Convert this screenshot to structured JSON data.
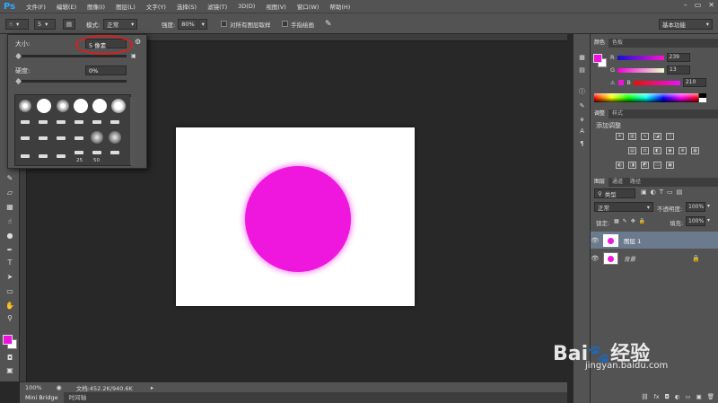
{
  "menubar": {
    "logo": "Ps",
    "items": [
      "文件(F)",
      "编辑(E)",
      "图像(I)",
      "图层(L)",
      "文字(Y)",
      "选择(S)",
      "滤镜(T)",
      "3D(D)",
      "视图(V)",
      "窗口(W)",
      "帮助(H)"
    ],
    "window_controls": [
      "–",
      "▭",
      "✕"
    ]
  },
  "options": {
    "brush_size": "5",
    "mode_label": "模式:",
    "mode_value": "正常",
    "strength_label": "强度:",
    "strength_value": "80%",
    "sample_all_label": "对所有图层取样",
    "finger_paint_label": "手指绘画",
    "workspace_value": "基本功能"
  },
  "brush_popup": {
    "size_label": "大小:",
    "size_value": "5 像素",
    "hardness_label": "硬度:",
    "hardness_value": "0%",
    "size_percent": 3,
    "hardness_percent": 0,
    "preset_numbers": [
      "25",
      "50"
    ]
  },
  "document": {
    "circle_color": "#ef17de",
    "background_color": "#ffffff"
  },
  "statusbar": {
    "zoom": "100%",
    "doc_info": "文档:452.2K/940.6K"
  },
  "bottom_tabs": [
    "Mini Bridge",
    "时间轴"
  ],
  "color_panel": {
    "tabs": [
      "颜色",
      "色板"
    ],
    "foreground": "#ef11de",
    "background": "#ffffff",
    "r_label": "R",
    "r_value": "239",
    "g_label": "G",
    "g_value": "13",
    "b_label": "B",
    "b_value": "210"
  },
  "adjustments_panel": {
    "tabs": [
      "调整",
      "样式"
    ],
    "heading": "添加调整"
  },
  "layers_panel": {
    "tabs": [
      "图层",
      "通道",
      "路径"
    ],
    "filter_value": "类型",
    "blend_mode": "正常",
    "opacity_label": "不透明度:",
    "opacity_value": "100%",
    "lock_label": "锁定:",
    "fill_label": "填充:",
    "fill_value": "100%",
    "layers": [
      {
        "name": "图层 1",
        "selected": true
      },
      {
        "name": "背景",
        "selected": false
      }
    ]
  },
  "watermark": {
    "brand": "Bai",
    "brand_suffix": "经验",
    "url": "jingyan.baidu.com"
  }
}
